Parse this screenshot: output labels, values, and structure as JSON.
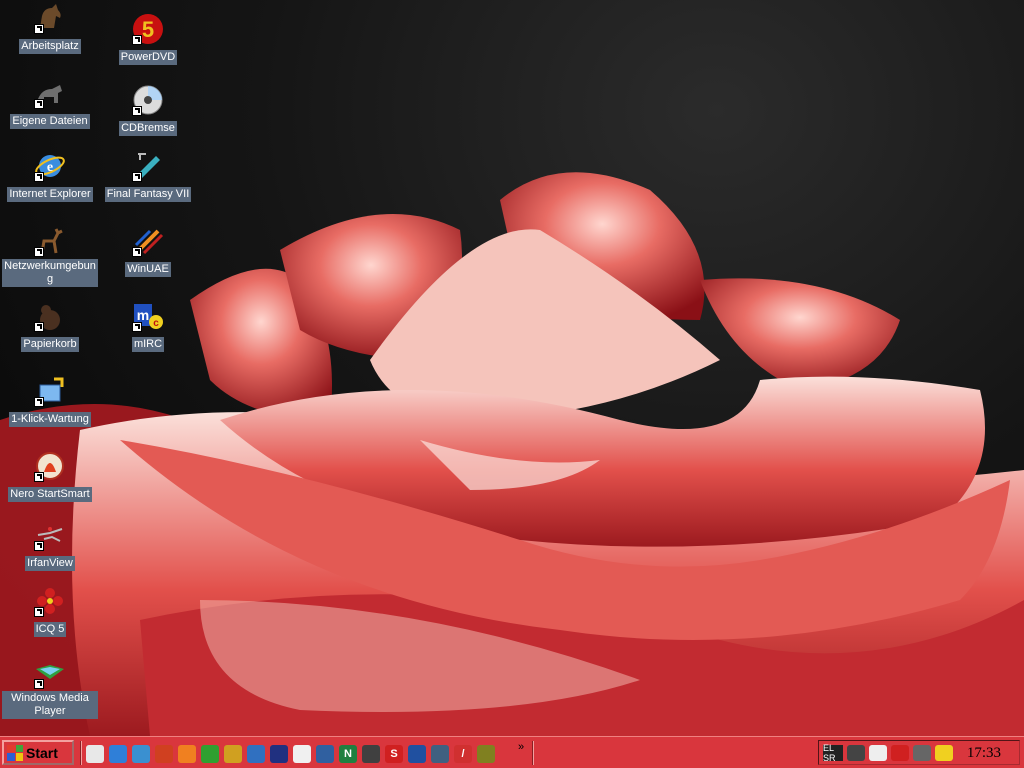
{
  "desktop_icons_col1": [
    {
      "label": "Arbeitsplatz",
      "icon": "horse-icon"
    },
    {
      "label": "Eigene Dateien",
      "icon": "animal-icon"
    },
    {
      "label": "Internet Explorer",
      "icon": "internet-explorer-icon"
    },
    {
      "label": "Netzwerkumgebung",
      "icon": "deer-icon"
    },
    {
      "label": "Papierkorb",
      "icon": "bear-icon"
    },
    {
      "label": "1-Klick-Wartung",
      "icon": "maintenance-icon"
    },
    {
      "label": "Nero StartSmart",
      "icon": "nero-icon"
    },
    {
      "label": "IrfanView",
      "icon": "irfanview-icon"
    },
    {
      "label": "ICQ 5",
      "icon": "icq-flower-icon"
    },
    {
      "label": "Windows Media Player",
      "icon": "media-player-icon"
    }
  ],
  "desktop_icons_col2": [
    {
      "label": "PowerDVD",
      "icon": "powerdvd-icon"
    },
    {
      "label": "CDBremse",
      "icon": "cd-icon"
    },
    {
      "label": "Final Fantasy VII",
      "icon": "final-fantasy-icon"
    },
    {
      "label": "WinUAE",
      "icon": "winuae-icon"
    },
    {
      "label": "mIRC",
      "icon": "mirc-icon"
    }
  ],
  "taskbar": {
    "start_label": "Start",
    "chevron": "»",
    "clock": "17:33",
    "quick_launch": [
      "show-desktop-icon",
      "internet-explorer-icon",
      "outlook-icon",
      "browser-icon",
      "firefox-icon",
      "media-icon",
      "tools-icon",
      "globe-icon",
      "save-icon",
      "ring-icon",
      "network-icon",
      "n-icon",
      "winamp-icon",
      "s-icon",
      "camera-icon",
      "drive-icon",
      "pen-icon",
      "game-icon"
    ],
    "tray_icons": [
      "keyboard-layout-icon",
      "volume-icon",
      "network-tray-icon",
      "antivirus-icon",
      "printer-icon",
      "warning-icon"
    ],
    "tray_keyboard_text": "EL SR"
  },
  "colors": {
    "taskbar": "#d9363d",
    "label_bg": "#5a6a7e"
  }
}
